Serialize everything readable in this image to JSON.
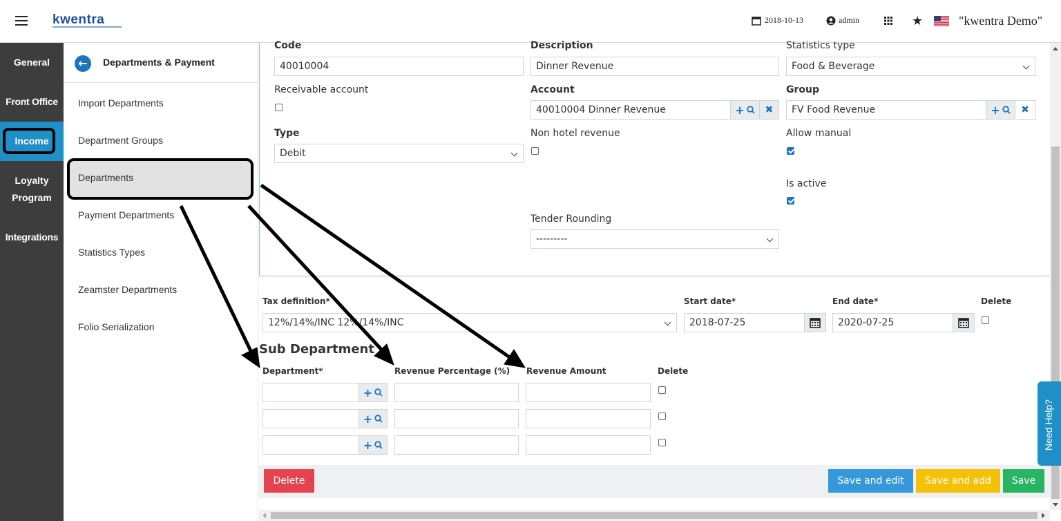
{
  "topbar": {
    "logo": "kwentra",
    "date": "2018-10-13",
    "user": "admin",
    "company": "\"kwentra Demo\""
  },
  "leftnav": {
    "items": [
      "General",
      "Front Office",
      "Income",
      "Loyalty",
      "Program",
      "Integrations"
    ]
  },
  "subnav": {
    "title": "Departments & Payment",
    "items": [
      "Import Departments",
      "Department Groups",
      "Departments",
      "Payment Departments",
      "Statistics Types",
      "Zeamster Departments",
      "Folio Serialization"
    ]
  },
  "form": {
    "code_label": "Code",
    "code_value": "40010004",
    "description_label": "Description",
    "description_value": "Dinner Revenue",
    "stat_type_label": "Statistics type",
    "stat_type_value": "Food & Beverage",
    "receivable_label": "Receivable account",
    "account_label": "Account",
    "account_value": "40010004 Dinner Revenue",
    "group_label": "Group",
    "group_value": "FV Food Revenue",
    "type_label": "Type",
    "type_value": "Debit",
    "non_hotel_label": "Non hotel revenue",
    "allow_manual_label": "Allow manual",
    "is_active_label": "Is active",
    "tender_label": "Tender Rounding",
    "tender_value": "---------"
  },
  "tax": {
    "definition_label": "Tax definition*",
    "definition_value": "12%/14%/INC 12%/14%/INC",
    "start_label": "Start date*",
    "start_value": "2018-07-25",
    "end_label": "End date*",
    "end_value": "2020-07-25",
    "delete_label": "Delete"
  },
  "sub_department": {
    "title": "Sub Department",
    "columns": [
      "Department*",
      "Revenue Percentage (%)",
      "Revenue Amount",
      "Delete"
    ]
  },
  "footer": {
    "delete": "Delete",
    "save_edit": "Save and edit",
    "save_add": "Save and add",
    "save": "Save"
  },
  "help": "Need Help?",
  "colors": {
    "accent": "#1e8fc7",
    "primary": "#1e73be",
    "delete": "#e5434f",
    "save_edit": "#3498db",
    "save_add": "#f5c107",
    "save": "#28b463",
    "nav_dark": "#3d3d3d"
  }
}
